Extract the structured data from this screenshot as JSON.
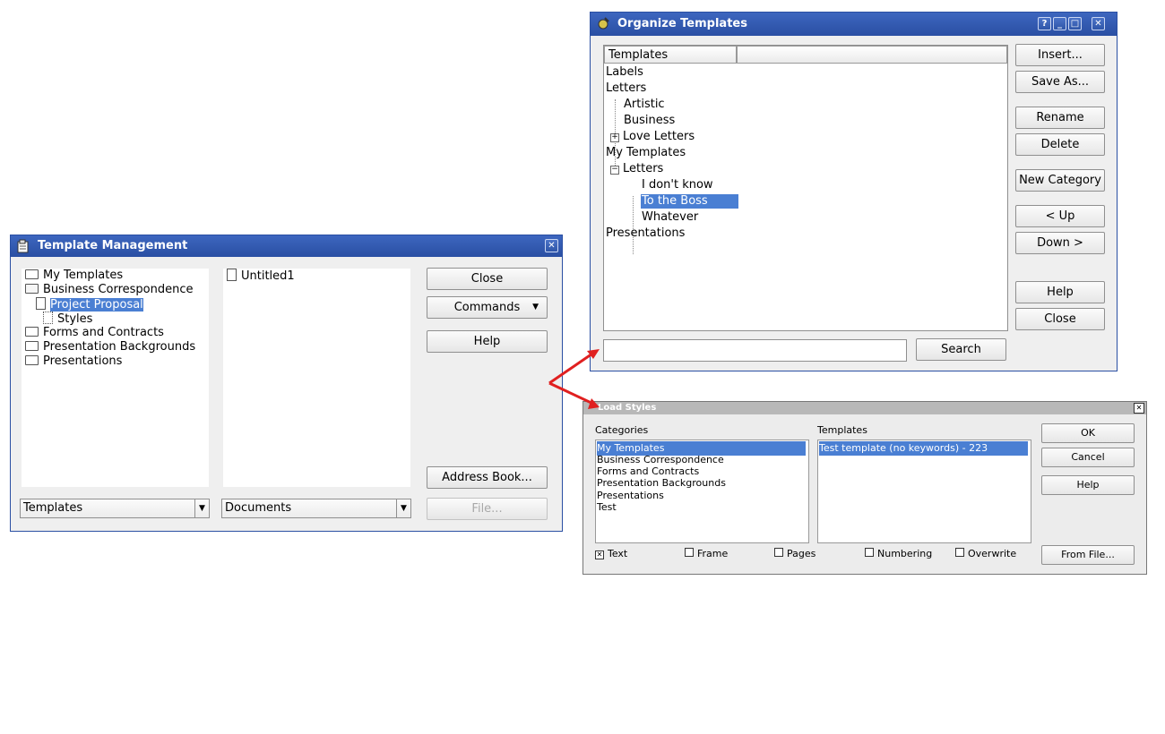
{
  "template_management": {
    "title": "Template Management",
    "left_tree": [
      {
        "label": "My Templates",
        "icon": "folder-icon"
      },
      {
        "label": "Business Correspondence",
        "icon": "folder-open-icon"
      },
      {
        "label": "Project Proposal",
        "icon": "document-icon",
        "selected": true
      },
      {
        "label": "Styles",
        "icon": "styles-icon"
      },
      {
        "label": "Forms and Contracts",
        "icon": "folder-icon"
      },
      {
        "label": "Presentation Backgrounds",
        "icon": "folder-icon"
      },
      {
        "label": "Presentations",
        "icon": "folder-icon"
      }
    ],
    "right_list": [
      {
        "label": "Untitled1",
        "icon": "document-icon"
      }
    ],
    "buttons": {
      "close": "Close",
      "commands": "Commands",
      "help": "Help",
      "address_book": "Address Book...",
      "file": "File..."
    },
    "combo_left": "Templates",
    "combo_right": "Documents"
  },
  "organize_templates": {
    "title": "Organize Templates",
    "column_header": "Templates",
    "tree": [
      {
        "label": "Labels"
      },
      {
        "label": "Letters"
      },
      {
        "label": "Artistic"
      },
      {
        "label": "Business"
      },
      {
        "label": "Love Letters"
      },
      {
        "label": "My Templates"
      },
      {
        "label": "Letters"
      },
      {
        "label": "I don't know"
      },
      {
        "label": "To the Boss",
        "selected": true
      },
      {
        "label": "Whatever"
      },
      {
        "label": "Presentations"
      }
    ],
    "buttons": {
      "insert": "Insert...",
      "save_as": "Save As...",
      "rename": "Rename",
      "delete": "Delete",
      "new_category": "New Category",
      "up": "< Up",
      "down": "Down >",
      "help": "Help",
      "close": "Close",
      "search": "Search"
    },
    "search_value": ""
  },
  "load_styles": {
    "title": "Load Styles",
    "categories_label": "Categories",
    "templates_label": "Templates",
    "categories": [
      "My Templates",
      "Business Correspondence",
      "Forms and Contracts",
      "Presentation Backgrounds",
      "Presentations",
      "Test"
    ],
    "templates": [
      "Test template (no keywords) - 223"
    ],
    "buttons": {
      "ok": "OK",
      "cancel": "Cancel",
      "help": "Help",
      "from_file": "From File..."
    },
    "checkboxes": [
      {
        "label": "Text",
        "checked": true
      },
      {
        "label": "Frame",
        "checked": false
      },
      {
        "label": "Pages",
        "checked": false
      },
      {
        "label": "Numbering",
        "checked": false
      },
      {
        "label": "Overwrite",
        "checked": false
      }
    ]
  },
  "colors": {
    "titlebar": "#2a4fa3",
    "selection": "#4a7fd3",
    "arrow": "#e02020"
  }
}
